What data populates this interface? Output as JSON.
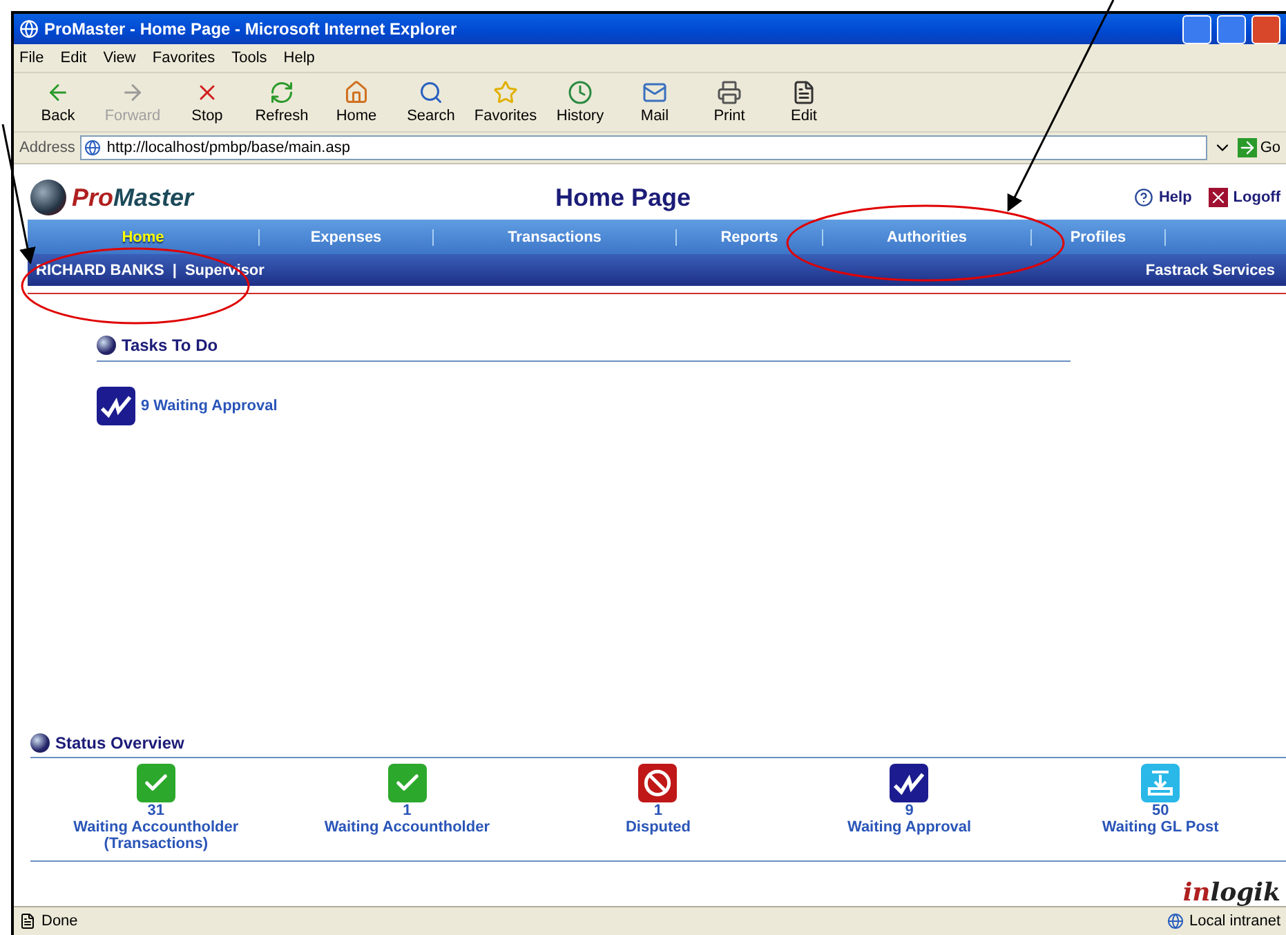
{
  "window": {
    "title": "ProMaster - Home Page - Microsoft Internet Explorer"
  },
  "menu": [
    "File",
    "Edit",
    "View",
    "Favorites",
    "Tools",
    "Help"
  ],
  "toolbar": [
    {
      "label": "Back",
      "kind": "back",
      "disabled": false
    },
    {
      "label": "Forward",
      "kind": "forward",
      "disabled": true
    },
    {
      "label": "Stop",
      "kind": "stop",
      "disabled": false
    },
    {
      "label": "Refresh",
      "kind": "refresh",
      "disabled": false
    },
    {
      "label": "Home",
      "kind": "home",
      "disabled": false
    },
    {
      "label": "Search",
      "kind": "search",
      "disabled": false
    },
    {
      "label": "Favorites",
      "kind": "favorites",
      "disabled": false
    },
    {
      "label": "History",
      "kind": "history",
      "disabled": false
    },
    {
      "label": "Mail",
      "kind": "mail",
      "disabled": false
    },
    {
      "label": "Print",
      "kind": "print",
      "disabled": false
    },
    {
      "label": "Edit",
      "kind": "edit",
      "disabled": false
    }
  ],
  "address": {
    "label": "Address",
    "value": "http://localhost/pmbp/base/main.asp",
    "go": "Go"
  },
  "page": {
    "logo_parts": [
      "Pro",
      "Master"
    ],
    "title": "Home Page",
    "help": "Help",
    "logoff": "Logoff",
    "nav": [
      {
        "label": "Home",
        "selected": true
      },
      {
        "label": "Expenses",
        "selected": false
      },
      {
        "label": "Transactions",
        "selected": false
      },
      {
        "label": "Reports",
        "selected": false
      },
      {
        "label": "Authorities",
        "selected": false
      },
      {
        "label": "Profiles",
        "selected": false
      }
    ],
    "user": "RICHARD BANKS",
    "user_separator": "|",
    "role": "Supervisor",
    "fastrack": "Fastrack Services",
    "tasks": {
      "heading": "Tasks To Do",
      "items": [
        {
          "label": "9 Waiting Approval",
          "kind": "approval"
        }
      ]
    },
    "status": {
      "heading": "Status Overview",
      "items": [
        {
          "count": "31",
          "label": "Waiting Accountholder",
          "sub": "(Transactions)",
          "kind": "check"
        },
        {
          "count": "1",
          "label": "Waiting Accountholder",
          "kind": "check"
        },
        {
          "count": "1",
          "label": "Disputed",
          "kind": "disputed"
        },
        {
          "count": "9",
          "label": "Waiting Approval",
          "kind": "approval"
        },
        {
          "count": "50",
          "label": "Waiting GL Post",
          "kind": "post"
        }
      ]
    },
    "brand_parts": [
      "in",
      "logik"
    ]
  },
  "status_bar": {
    "text": "Done",
    "zone": "Local intranet"
  }
}
